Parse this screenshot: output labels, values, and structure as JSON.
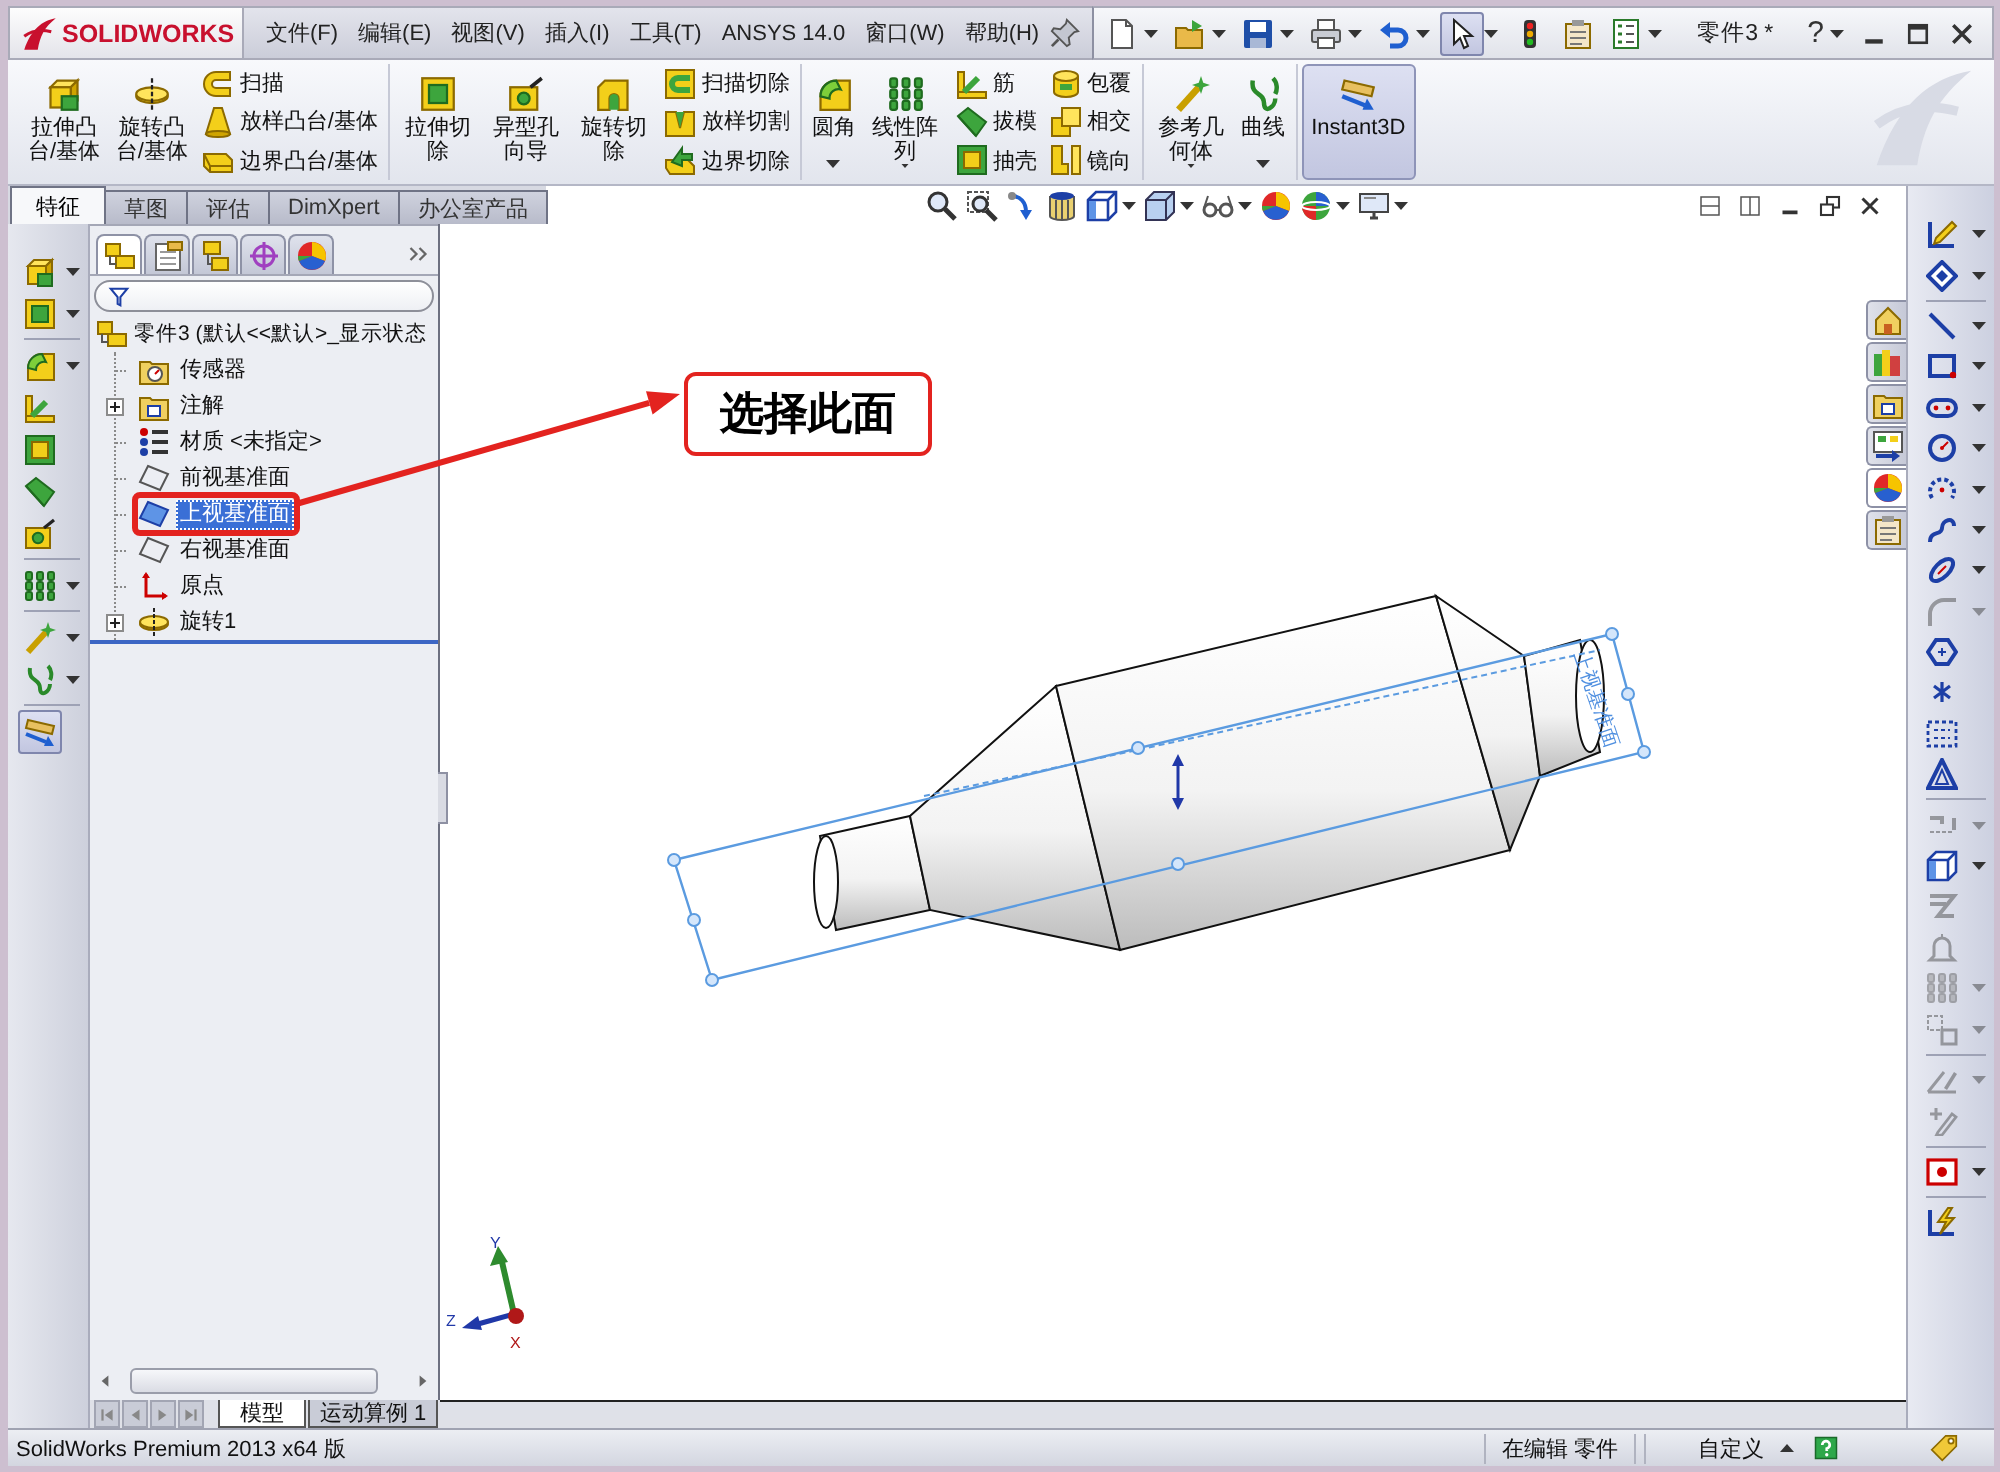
{
  "title_bar": {
    "logo": "SOLIDWORKS",
    "menu": [
      "文件(F)",
      "编辑(E)",
      "视图(V)",
      "插入(I)",
      "工具(T)",
      "ANSYS 14.0",
      "窗口(W)",
      "帮助(H)"
    ],
    "quick_access": [
      {
        "dropdown": true,
        "on": false
      },
      {
        "dropdown": true,
        "on": false
      },
      {
        "dropdown": true,
        "on": false
      },
      {
        "dropdown": true,
        "on": false
      },
      {
        "dropdown": true,
        "on": false
      },
      {
        "dropdown": true,
        "on": true
      },
      {
        "dropdown": false,
        "on": false
      },
      {
        "dropdown": false,
        "on": false
      },
      {
        "dropdown": true,
        "on": false
      }
    ],
    "document": "零件3 *",
    "help": "?"
  },
  "ribbon": [
    [
      {
        "kind": "large",
        "label": "拉伸凸台/基体",
        "dropdown": false,
        "on": false
      },
      {
        "kind": "large",
        "label": "旋转凸台/基体",
        "dropdown": false,
        "on": false
      },
      {
        "kind": "stack",
        "items": [
          "扫描",
          "放样凸台/基体",
          "边界凸台/基体"
        ]
      }
    ],
    [
      {
        "kind": "large",
        "label": "拉伸切除",
        "dropdown": false,
        "on": false
      },
      {
        "kind": "large",
        "label": "异型孔向导",
        "dropdown": false,
        "on": false
      },
      {
        "kind": "large",
        "label": "旋转切除",
        "dropdown": false,
        "on": false
      },
      {
        "kind": "stack",
        "items": [
          "扫描切除",
          "放样切割",
          "边界切除"
        ]
      }
    ],
    [
      {
        "kind": "large",
        "label": "圆角",
        "dropdown": true,
        "on": false
      },
      {
        "kind": "large",
        "label": "线性阵列",
        "dropdown": true,
        "on": false
      },
      {
        "kind": "stack",
        "items": [
          "筋",
          "拔模",
          "抽壳"
        ]
      },
      {
        "kind": "stack",
        "items": [
          "包覆",
          "相交",
          "镜向"
        ]
      }
    ],
    [
      {
        "kind": "large",
        "label": "参考几何体",
        "dropdown": true,
        "on": false
      },
      {
        "kind": "large",
        "label": "曲线",
        "dropdown": true,
        "on": false
      }
    ],
    [
      {
        "kind": "large",
        "label": "Instant3D",
        "dropdown": false,
        "on": true
      }
    ]
  ],
  "tabs": [
    {
      "label": "特征",
      "selected": true
    },
    {
      "label": "草图",
      "selected": false
    },
    {
      "label": "评估",
      "selected": false
    },
    {
      "label": "DimXpert",
      "selected": false
    },
    {
      "label": "办公室产品",
      "selected": false
    }
  ],
  "heads_up_toolbar": [
    {
      "dropdown": false
    },
    {
      "dropdown": false
    },
    {
      "dropdown": false
    },
    {
      "dropdown": false
    },
    {
      "dropdown": true
    },
    {
      "dropdown": true
    },
    {
      "dropdown": true
    },
    {
      "dropdown": false
    },
    {
      "dropdown": true
    },
    {
      "dropdown": true
    }
  ],
  "left_toolbar": [
    [
      {
        "dropdown": true,
        "on": false
      },
      {
        "dropdown": true,
        "on": false
      }
    ],
    [
      {
        "dropdown": true,
        "on": false
      },
      {
        "dropdown": false,
        "on": false
      },
      {
        "dropdown": false,
        "on": false
      },
      {
        "dropdown": false,
        "on": false
      },
      {
        "dropdown": false,
        "on": false
      }
    ],
    [
      {
        "dropdown": true,
        "on": false
      }
    ],
    [
      {
        "dropdown": true,
        "on": false
      },
      {
        "dropdown": true,
        "on": false
      }
    ],
    [
      {
        "dropdown": false,
        "on": true
      }
    ]
  ],
  "feature_manager": {
    "tabs": [
      {
        "selected": true
      },
      {
        "selected": false
      },
      {
        "selected": false
      },
      {
        "selected": false
      },
      {
        "selected": false
      }
    ],
    "tree": {
      "label": "零件3 (默认<<默认>_显示状态",
      "selected": false,
      "children": [
        {
          "label": "传感器",
          "selected": false,
          "collapsed": false,
          "highlighted": false
        },
        {
          "label": "注解",
          "selected": false,
          "collapsed": true,
          "highlighted": false
        },
        {
          "label": "材质 <未指定>",
          "selected": false,
          "collapsed": false,
          "highlighted": false
        },
        {
          "label": "前视基准面",
          "selected": false,
          "collapsed": false,
          "highlighted": false
        },
        {
          "label": "上视基准面",
          "selected": true,
          "collapsed": false,
          "highlighted": true
        },
        {
          "label": "右视基准面",
          "selected": false,
          "collapsed": false,
          "highlighted": false
        },
        {
          "label": "原点",
          "selected": false,
          "collapsed": false,
          "highlighted": false
        },
        {
          "label": "旋转1",
          "selected": false,
          "collapsed": true,
          "highlighted": false
        }
      ]
    }
  },
  "graphics": {
    "callout": "选择此面",
    "plane_label": "上视基准面",
    "axes": [
      "Y",
      "Z",
      "X"
    ]
  },
  "task_pane": [
    {
      "selected": false
    },
    {
      "selected": false
    },
    {
      "selected": false
    },
    {
      "selected": false
    },
    {
      "selected": true
    },
    {
      "selected": false
    }
  ],
  "sketch_toolbar": [
    [
      {
        "dropdown": true,
        "disabled": false
      },
      {
        "dropdown": true,
        "disabled": false
      }
    ],
    [
      {
        "dropdown": true,
        "disabled": false
      },
      {
        "dropdown": true,
        "disabled": false
      },
      {
        "dropdown": true,
        "disabled": false
      },
      {
        "dropdown": true,
        "disabled": false
      },
      {
        "dropdown": true,
        "disabled": false
      },
      {
        "dropdown": true,
        "disabled": false
      },
      {
        "dropdown": true,
        "disabled": false
      },
      {
        "dropdown": true,
        "disabled": true
      },
      {
        "dropdown": false,
        "disabled": false
      },
      {
        "dropdown": false,
        "disabled": false
      },
      {
        "dropdown": false,
        "disabled": false
      },
      {
        "dropdown": false,
        "disabled": false
      }
    ],
    [
      {
        "dropdown": true,
        "disabled": true
      },
      {
        "dropdown": true,
        "disabled": false
      },
      {
        "dropdown": false,
        "disabled": true
      },
      {
        "dropdown": false,
        "disabled": true
      },
      {
        "dropdown": true,
        "disabled": true
      },
      {
        "dropdown": true,
        "disabled": true
      }
    ],
    [
      {
        "dropdown": true,
        "disabled": true
      },
      {
        "dropdown": false,
        "disabled": true
      }
    ],
    [
      {
        "dropdown": true,
        "disabled": false
      }
    ],
    [
      {
        "dropdown": false,
        "disabled": false
      }
    ]
  ],
  "bottom_tabs": [
    {
      "label": "模型",
      "selected": true
    },
    {
      "label": "运动算例 1",
      "selected": false
    }
  ],
  "status_bar": {
    "product": "SolidWorks Premium 2013 x64 版",
    "mode": "在编辑 零件",
    "units": "自定义"
  }
}
